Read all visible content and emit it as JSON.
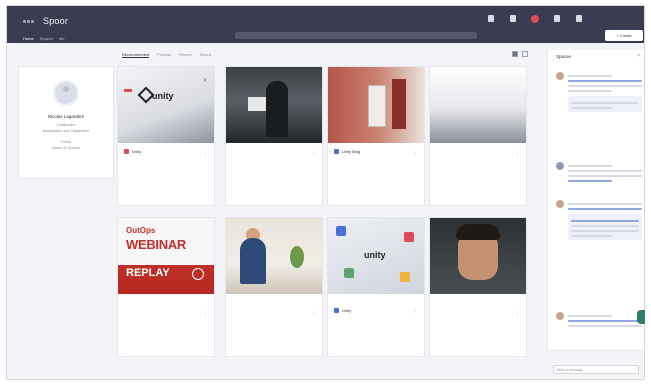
{
  "topbar": {
    "brand": "Spoor",
    "tabs": [
      "Home",
      "Spaces",
      "Me"
    ],
    "search_placeholder": "",
    "icons": [
      {
        "name": "notes-icon",
        "label": ""
      },
      {
        "name": "pin-icon",
        "label": ""
      },
      {
        "name": "bell-icon",
        "label": ""
      },
      {
        "name": "inbox-icon",
        "label": ""
      },
      {
        "name": "grid-icon",
        "label": ""
      }
    ],
    "action_button": "+ Create"
  },
  "profile": {
    "name": "Nicolas Lagardere",
    "lines": [
      "Collaborator",
      "Ambassador and Collaborator",
      "Follow",
      "Space 10 Spaces"
    ]
  },
  "feed": {
    "tabs": [
      "Recommended",
      "Popular",
      "Recent",
      "Saved"
    ],
    "active_tab": 0
  },
  "cards": [
    {
      "tag": "Unity",
      "thumb": "unity",
      "title": "",
      "accent": "",
      "meta": "",
      "author": "",
      "date": ""
    },
    {
      "tag": "",
      "thumb": "dark",
      "title": "",
      "accent": "",
      "meta": "",
      "author": "",
      "date": ""
    },
    {
      "tag": "Unity Blog",
      "thumb": "brick",
      "title": "",
      "accent": "",
      "meta": "",
      "author": "",
      "date": ""
    },
    {
      "tag": "",
      "thumb": "blank",
      "title": "",
      "accent": "",
      "meta": "",
      "author": "",
      "date": ""
    },
    {
      "tag": "",
      "thumb": "webinar",
      "title": "",
      "accent": "",
      "meta": "",
      "author": "",
      "date": ""
    },
    {
      "tag": "",
      "thumb": "office",
      "title": "",
      "accent": "",
      "meta": "",
      "author": "",
      "date": ""
    },
    {
      "tag": "Unity",
      "thumb": "unity2",
      "title": "",
      "accent": "",
      "meta": "",
      "author": "",
      "date": ""
    },
    {
      "tag": "",
      "thumb": "portrait",
      "title": "",
      "accent": "",
      "meta": "",
      "author": "",
      "date": ""
    }
  ],
  "thumbs": {
    "unity_logo": "unity",
    "webinar_line1": "OutOps",
    "webinar_line2": "WEBINAR",
    "webinar_line3": "REPLAY"
  },
  "right_panel": {
    "title": "Spaces",
    "input_hint": "",
    "input_placeholder": "Write a message"
  },
  "colors": {
    "topbar": "#3a3d52",
    "accent_red": "#e04a57",
    "link_blue": "#4a6fd8"
  }
}
